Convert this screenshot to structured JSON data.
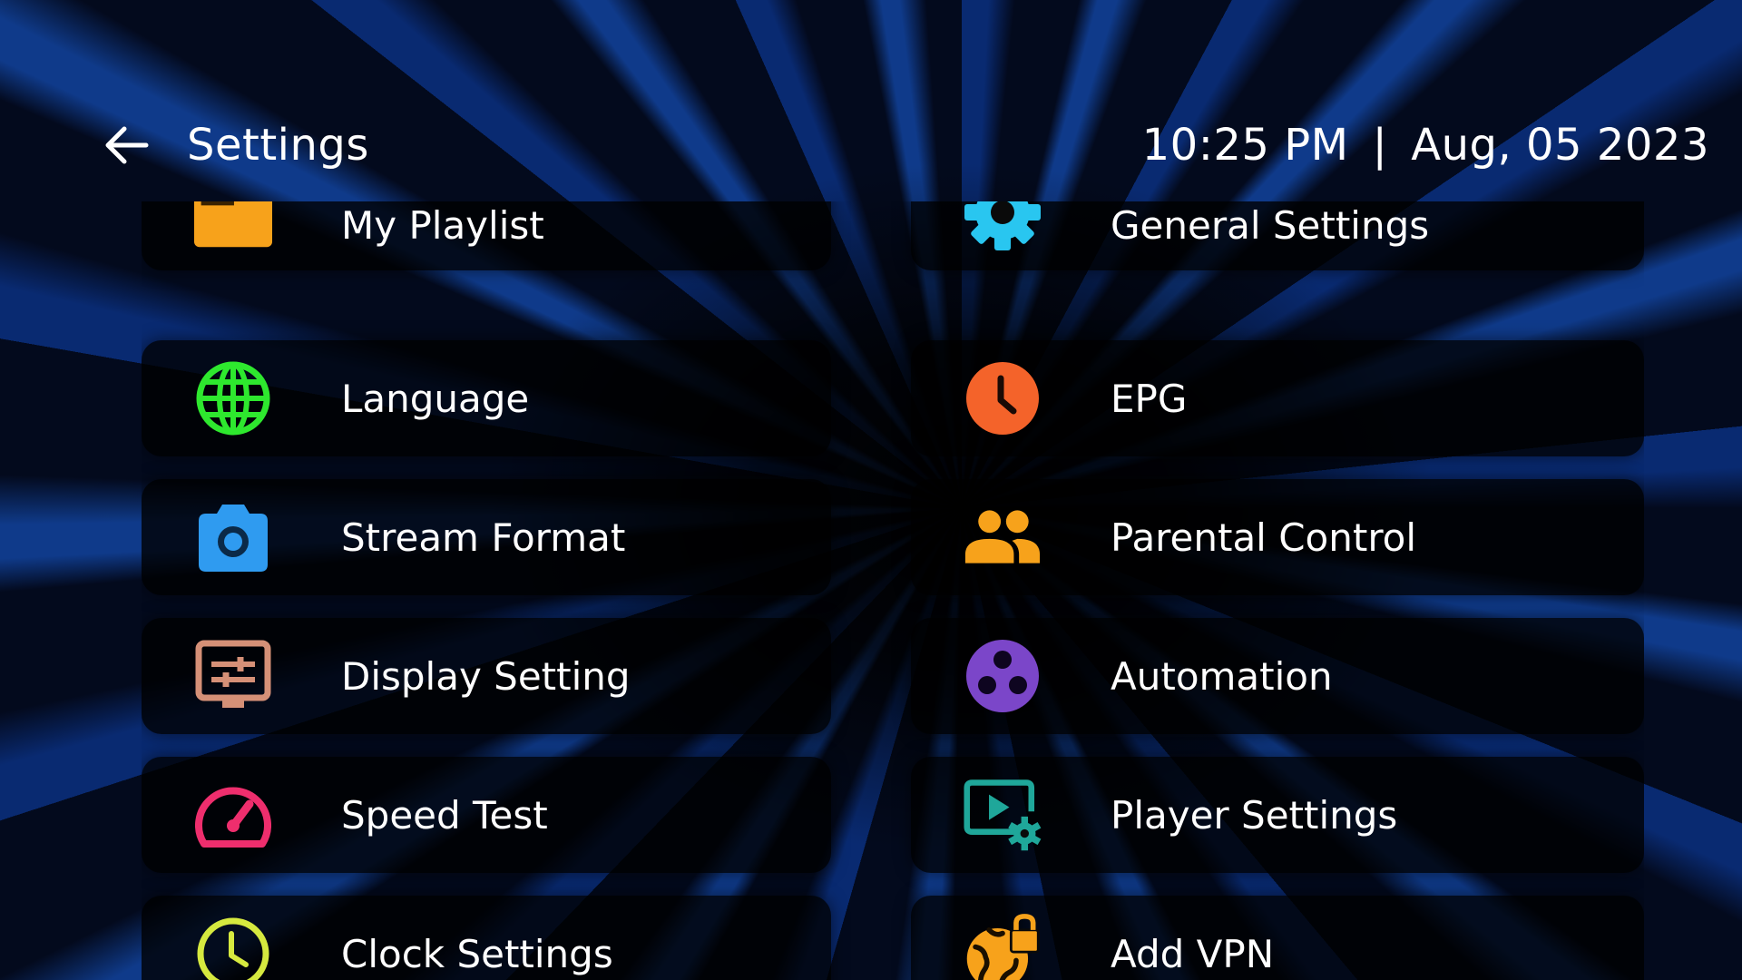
{
  "header": {
    "title": "Settings",
    "time": "10:25 PM",
    "separator": "|",
    "date": "Aug, 05 2023"
  },
  "items": [
    {
      "label": "My Playlist",
      "icon": "playlist-icon",
      "color": "#f7a21b"
    },
    {
      "label": "General Settings",
      "icon": "gear-icon",
      "color": "#29c6f0"
    },
    {
      "label": "Language",
      "icon": "globe-icon",
      "color": "#2ee82e"
    },
    {
      "label": "EPG",
      "icon": "clock-icon",
      "color": "#f4632a"
    },
    {
      "label": "Stream Format",
      "icon": "camera-icon",
      "color": "#2f9bf0"
    },
    {
      "label": "Parental Control",
      "icon": "people-icon",
      "color": "#f7a21b"
    },
    {
      "label": "Display Setting",
      "icon": "monitor-sliders-icon",
      "color": "#d59077"
    },
    {
      "label": "Automation",
      "icon": "automation-icon",
      "color": "#7b46c9"
    },
    {
      "label": "Speed Test",
      "icon": "speedometer-icon",
      "color": "#ee2e6d"
    },
    {
      "label": "Player Settings",
      "icon": "player-settings-icon",
      "color": "#1fa79a"
    },
    {
      "label": "Clock Settings",
      "icon": "clock-icon",
      "color": "#d6e93f"
    },
    {
      "label": "Add VPN",
      "icon": "vpn-globe-lock-icon",
      "color": "#f7a21b"
    }
  ]
}
